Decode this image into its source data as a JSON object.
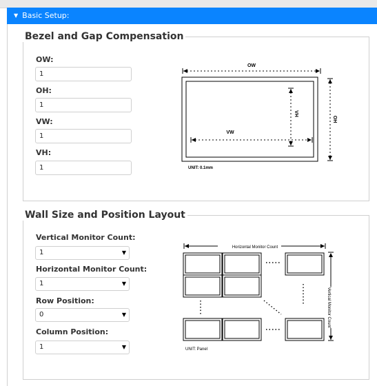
{
  "section_header": {
    "title": "Basic Setup:"
  },
  "bezel": {
    "legend": "Bezel and Gap Compensation",
    "fields": [
      {
        "label": "OW:",
        "value": "1"
      },
      {
        "label": "OH:",
        "value": "1"
      },
      {
        "label": "VW:",
        "value": "1"
      },
      {
        "label": "VH:",
        "value": "1"
      }
    ],
    "diagram": {
      "ow": "OW",
      "oh": "OH",
      "vw": "VW",
      "vh": "VH",
      "unit": "UNIT: 0.1mm"
    }
  },
  "wall": {
    "legend": "Wall Size and Position Layout",
    "fields": [
      {
        "label": "Vertical Monitor Count:",
        "value": "1"
      },
      {
        "label": "Horizontal Monitor Count:",
        "value": "1"
      },
      {
        "label": "Row Position:",
        "value": "0"
      },
      {
        "label": "Column Position:",
        "value": "1"
      }
    ],
    "diagram": {
      "horizontal": "Horizontal Monitor Count",
      "vertical": "Vertical Monitor Count",
      "unit": "UNIT: Panel"
    }
  },
  "icons": {
    "collapse": "caret-down-icon",
    "dropdown": "chevron-down-icon"
  }
}
